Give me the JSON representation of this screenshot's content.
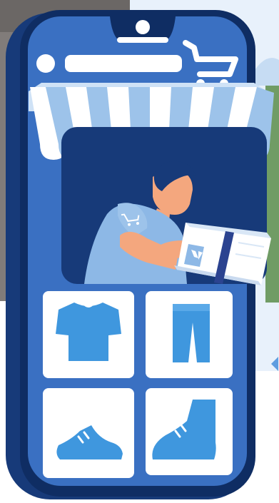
{
  "scene": {
    "colors": {
      "background": "#ffffff",
      "panel_light": "#e8f1fb",
      "navy": "#173a79",
      "navy_dark": "#0f2d63",
      "phone_blue": "#3a70c2",
      "sky_blue": "#9dc3ea",
      "icon_blue": "#3f97de",
      "white": "#ffffff",
      "skin": "#f4a77e",
      "shirt": "#8db8e6",
      "box_stripe": "#2b4390"
    },
    "icons": [
      "camera-icon",
      "search-bar-icon",
      "shopping-cart-icon",
      "awning-icon",
      "shopkeeper-icon",
      "package-icon",
      "tshirt-icon",
      "pants-icon",
      "sneaker-icon",
      "boot-icon"
    ]
  }
}
